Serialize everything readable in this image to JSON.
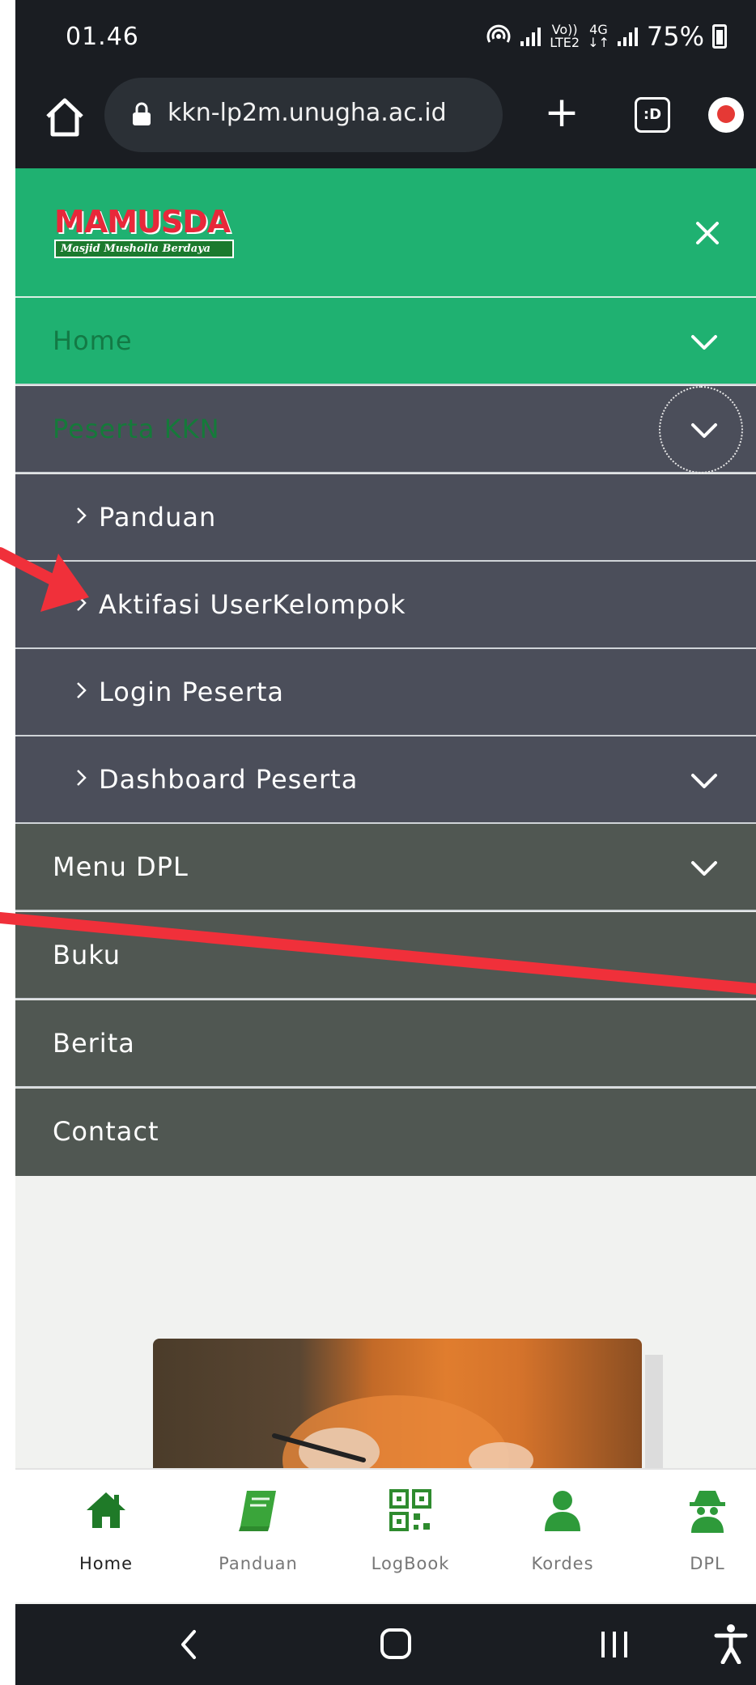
{
  "status_bar": {
    "time": "01.46",
    "network_top": "Vo))",
    "network_bottom": "LTE2",
    "data_top": "4G",
    "data_bottom": "↓↑",
    "battery": "75%"
  },
  "browser": {
    "url": "kkn-lp2m.unugha.ac.id",
    "tabs_label": ":D"
  },
  "logo": {
    "title": "MAMUSDA",
    "subtitle": "Masjid Musholla Berdaya"
  },
  "menu": {
    "home": "Home",
    "peserta": "Peserta KKN",
    "panduan": "Panduan",
    "aktifasi": "Aktifasi UserKelompok",
    "login": "Login Peserta",
    "dashboard": "Dashboard Peserta",
    "dpl": "Menu DPL",
    "buku": "Buku",
    "berita": "Berita",
    "contact": "Contact"
  },
  "bottom_nav": {
    "home": "Home",
    "panduan": "Panduan",
    "logbook": "LogBook",
    "kordes": "Kordes",
    "dpl": "DPL"
  },
  "colors": {
    "brand_green": "#1fb171",
    "submenu_bg": "#4b4e5a",
    "menu_bg": "#505752",
    "nav_icon_green": "#2e8b2e",
    "annotation_red": "#f0303a"
  },
  "icons": [
    "home-icon",
    "lock-icon",
    "plus-icon",
    "tabs-icon",
    "upload-icon",
    "close-icon",
    "chevron-down-icon",
    "chevron-right-icon",
    "book-icon",
    "qr-code-icon",
    "person-icon",
    "spy-icon",
    "back-icon",
    "recent-apps-icon",
    "accessibility-icon"
  ]
}
